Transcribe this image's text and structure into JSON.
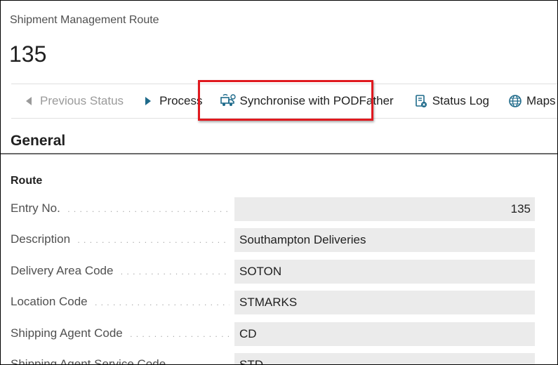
{
  "header": {
    "caption": "Shipment Management Route",
    "record_no": "135"
  },
  "actions": [
    {
      "label": "Previous Status",
      "icon": "triangle-left-icon",
      "enabled": false
    },
    {
      "label": "Process",
      "icon": "play-icon",
      "enabled": true
    },
    {
      "label": "Synchronise with PODFather",
      "icon": "truck-sync-icon",
      "enabled": true,
      "highlighted": true
    },
    {
      "label": "Status Log",
      "icon": "log-icon",
      "enabled": true
    },
    {
      "label": "Maps",
      "icon": "globe-icon",
      "enabled": true
    }
  ],
  "highlight_color": "#e0191f",
  "section": {
    "title": "General",
    "group": "Route",
    "fields": [
      {
        "label": "Entry No.",
        "value": "135"
      },
      {
        "label": "Description",
        "value": "Southampton Deliveries"
      },
      {
        "label": "Delivery Area Code",
        "value": "SOTON"
      },
      {
        "label": "Location Code",
        "value": "STMARKS"
      },
      {
        "label": "Shipping Agent Code",
        "value": "CD"
      },
      {
        "label": "Shipping Agent Service Code",
        "value": "STD"
      }
    ]
  }
}
